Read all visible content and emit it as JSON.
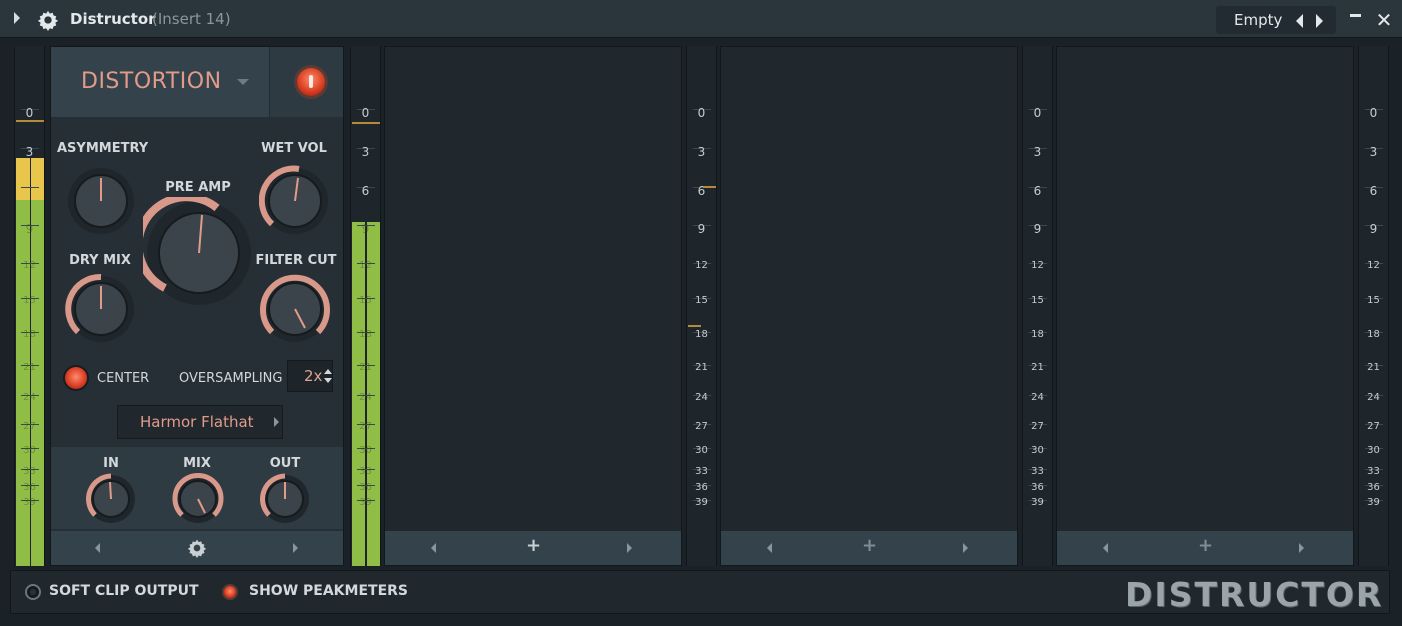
{
  "window": {
    "title": "Distructor",
    "subtitle": "(Insert 14)",
    "preset": "Empty"
  },
  "meter_scale": [
    "0",
    "3",
    "6",
    "9",
    "12",
    "15",
    "18",
    "21",
    "24",
    "27",
    "30",
    "33",
    "36",
    "39"
  ],
  "input_meter_scale": [
    "0",
    "3",
    "",
    "9",
    "12",
    "15",
    "18",
    "21",
    "24",
    "27",
    "30",
    "33",
    "36",
    "39"
  ],
  "module": {
    "type_label": "DISTORTION",
    "knobs": {
      "asymmetry": "ASYMMETRY",
      "pre_amp": "PRE AMP",
      "wet_vol": "WET VOL",
      "dry_mix": "DRY MIX",
      "filter_cut": "FILTER CUT"
    },
    "center_label": "CENTER",
    "oversampling_label": "OVERSAMPLING",
    "oversampling_value": "2x",
    "model": "Harmor Flathat",
    "io": {
      "in": "IN",
      "mix": "MIX",
      "out": "OUT"
    }
  },
  "slot_plus": "+",
  "bottom": {
    "soft_clip": "SOFT CLIP OUTPUT",
    "show_peakmeters": "SHOW PEAKMETERS",
    "brand": "DISTRUCTOR"
  },
  "colors": {
    "accent": "#e29b8a",
    "meter_green": "#8fbd45",
    "meter_yellow": "#e8c64c",
    "led_red": "#e0452a"
  }
}
